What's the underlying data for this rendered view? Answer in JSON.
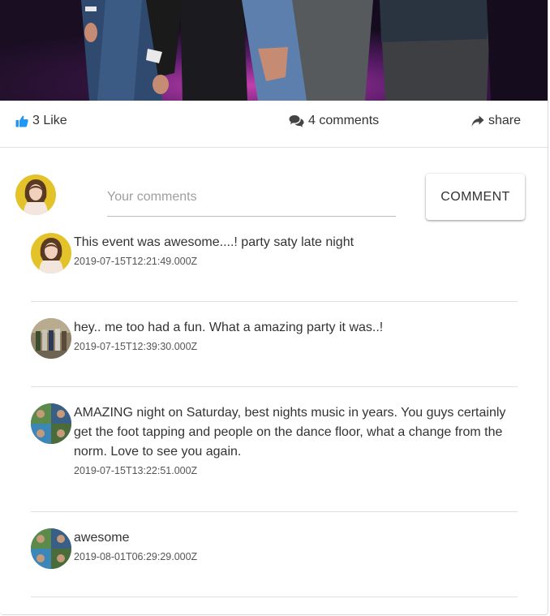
{
  "post": {
    "like_count_label": "3 Like",
    "comments_count_label": "4 comments",
    "share_label": "share",
    "accent_color": "#2196f3"
  },
  "composer": {
    "placeholder": "Your comments",
    "submit_label": "COMMENT"
  },
  "comments": [
    {
      "text": "This event was awesome....! party saty late night",
      "timestamp": "2019-07-15T12:21:49.000Z"
    },
    {
      "text": "hey.. me too had a fun. What a amazing party it was..!",
      "timestamp": "2019-07-15T12:39:30.000Z"
    },
    {
      "text": "AMAZING night on Saturday, best nights music in years. You guys certainly get the foot tapping and people on the dance floor, what a change from the norm. Love to see you again.",
      "timestamp": "2019-07-15T13:22:51.000Z"
    },
    {
      "text": "awesome",
      "timestamp": "2019-08-01T06:29:29.000Z"
    }
  ],
  "icons": {
    "like": "thumbs-up-icon",
    "comments": "chat-bubbles-icon",
    "share": "share-arrow-icon"
  }
}
